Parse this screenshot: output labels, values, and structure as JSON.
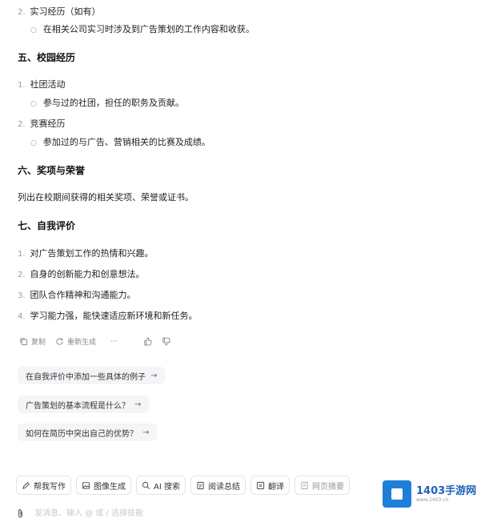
{
  "sections": {
    "internship": {
      "num": "2.",
      "label": "实习经历（如有）",
      "sub": "在相关公司实习时涉及到广告策划的工作内容和收获。"
    },
    "campus": {
      "title": "五、校园经历",
      "items": [
        {
          "num": "1.",
          "label": "社团活动",
          "sub": "参与过的社团，担任的职务及贡献。"
        },
        {
          "num": "2.",
          "label": "竞赛经历",
          "sub": "参加过的与广告、营销相关的比赛及成绩。"
        }
      ]
    },
    "awards": {
      "title": "六、奖项与荣誉",
      "text": "列出在校期间获得的相关奖项、荣誉或证书。"
    },
    "self_eval": {
      "title": "七、自我评价",
      "items": [
        {
          "num": "1.",
          "label": "对广告策划工作的热情和兴趣。"
        },
        {
          "num": "2.",
          "label": "自身的创新能力和创意想法。"
        },
        {
          "num": "3.",
          "label": "团队合作精神和沟通能力。"
        },
        {
          "num": "4.",
          "label": "学习能力强，能快速适应新环境和新任务。"
        }
      ]
    }
  },
  "actions": {
    "copy": "复制",
    "regenerate": "重新生成",
    "more": "···"
  },
  "suggestions": [
    "在自我评价中添加一些具体的例子",
    "广告策划的基本流程是什么？",
    "如何在简历中突出自己的优势？"
  ],
  "suggestion_arrow": "→",
  "toolbar": {
    "write": "帮我写作",
    "image": "图像生成",
    "ai_search": "AI 搜索",
    "summary": "阅读总结",
    "translate": "翻译",
    "web_summary": "网页摘要"
  },
  "input": {
    "placeholder": "发消息、输入 @ 或 / 选择技能"
  },
  "watermark": {
    "name": "1403手游网",
    "url": "www.1403.cn"
  }
}
